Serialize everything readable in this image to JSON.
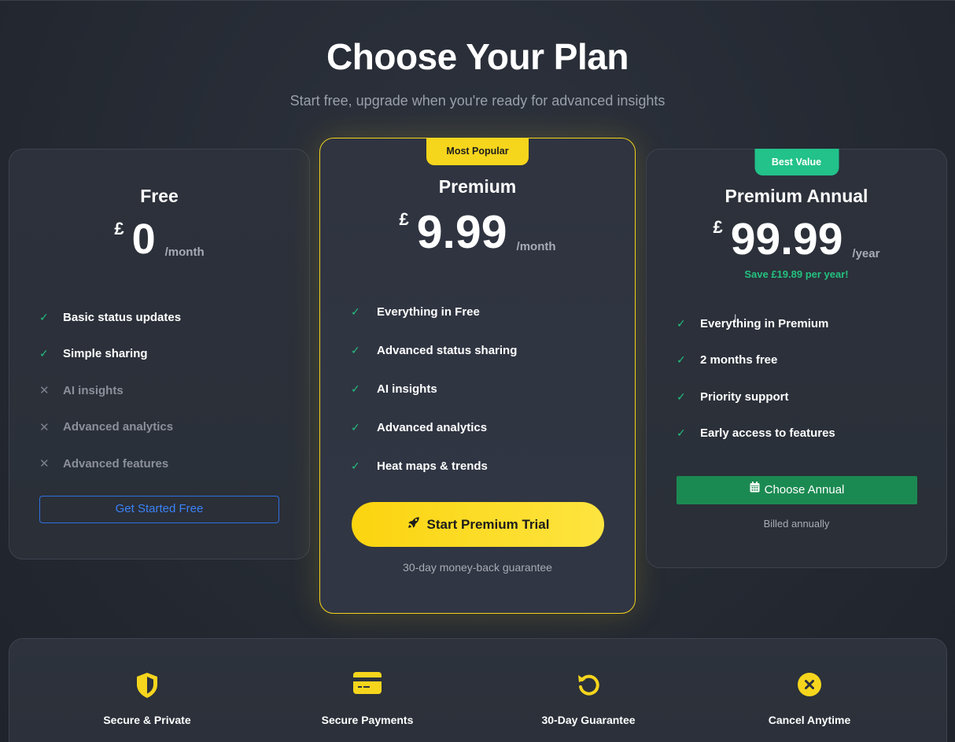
{
  "header": {
    "title": "Choose Your Plan",
    "subtitle": "Start free, upgrade when you're ready for advanced insights"
  },
  "plans": {
    "free": {
      "name": "Free",
      "currency": "£",
      "amount": "0",
      "period": "/month",
      "features": [
        {
          "label": "Basic status updates",
          "included": true
        },
        {
          "label": "Simple sharing",
          "included": true
        },
        {
          "label": "AI insights",
          "included": false
        },
        {
          "label": "Advanced analytics",
          "included": false
        },
        {
          "label": "Advanced features",
          "included": false
        }
      ],
      "button": "Get Started Free"
    },
    "premium": {
      "badge": "Most Popular",
      "name": "Premium",
      "currency": "£",
      "amount": "9.99",
      "period": "/month",
      "features": [
        {
          "label": "Everything in Free",
          "included": true
        },
        {
          "label": "Advanced status sharing",
          "included": true
        },
        {
          "label": "AI insights",
          "included": true
        },
        {
          "label": "Advanced analytics",
          "included": true
        },
        {
          "label": "Heat maps & trends",
          "included": true
        }
      ],
      "button": "Start Premium Trial",
      "button_icon": "rocket-icon",
      "note": "30-day money-back guarantee"
    },
    "annual": {
      "badge": "Best Value",
      "name": "Premium Annual",
      "currency": "£",
      "amount": "99.99",
      "period": "/year",
      "save_note": "Save £19.89 per year!",
      "features": [
        {
          "label": "Everything in Premium",
          "included": true
        },
        {
          "label": "2 months free",
          "included": true
        },
        {
          "label": "Priority support",
          "included": true
        },
        {
          "label": "Early access to features",
          "included": true
        }
      ],
      "button": "Choose Annual",
      "button_icon": "calendar-icon",
      "note": "Billed annually"
    }
  },
  "trust": [
    {
      "label": "Secure & Private",
      "icon": "shield-icon"
    },
    {
      "label": "Secure Payments",
      "icon": "credit-card-icon"
    },
    {
      "label": "30-Day Guarantee",
      "icon": "undo-icon"
    },
    {
      "label": "Cancel Anytime",
      "icon": "cancel-icon"
    }
  ],
  "colors": {
    "accent_yellow": "#f6d51d",
    "accent_green": "#22c28a",
    "button_green": "#1b8a52",
    "link_blue": "#3b82f6",
    "check_green": "#22c07e"
  }
}
